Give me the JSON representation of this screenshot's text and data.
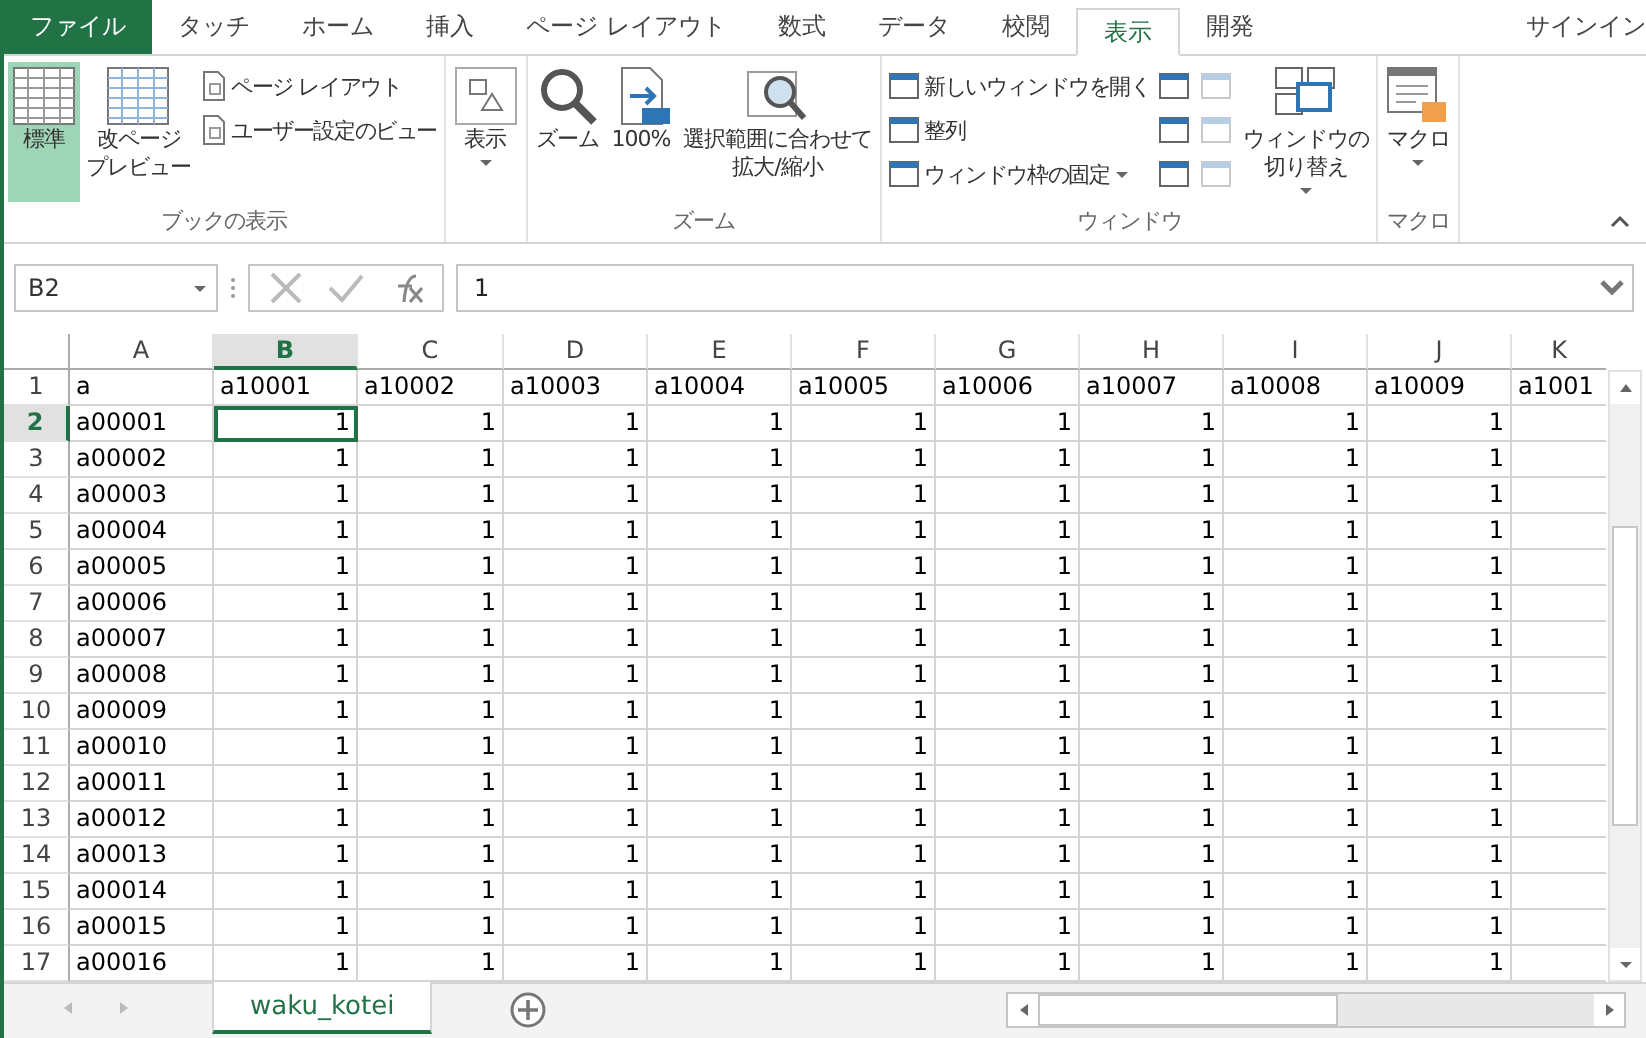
{
  "menu_tabs": [
    {
      "label": "ファイル",
      "kind": "file",
      "selected": false
    },
    {
      "label": "タッチ",
      "kind": "tab",
      "selected": false
    },
    {
      "label": "ホーム",
      "kind": "tab",
      "selected": false
    },
    {
      "label": "挿入",
      "kind": "tab",
      "selected": false
    },
    {
      "label": "ページ レイアウト",
      "kind": "tab",
      "selected": false
    },
    {
      "label": "数式",
      "kind": "tab",
      "selected": false
    },
    {
      "label": "データ",
      "kind": "tab",
      "selected": false
    },
    {
      "label": "校閲",
      "kind": "tab",
      "selected": false
    },
    {
      "label": "表示",
      "kind": "tab",
      "selected": true
    },
    {
      "label": "開発",
      "kind": "tab",
      "selected": false
    }
  ],
  "sign_in": "サインイン",
  "ribbon_groups": [
    {
      "label": "ブックの表示",
      "items": [
        {
          "kind": "large",
          "lines": [
            "標準"
          ],
          "selected": true,
          "dropdown": false
        },
        {
          "kind": "large",
          "lines": [
            "改ページ",
            "プレビュー"
          ],
          "selected": false,
          "dropdown": false
        },
        {
          "kind": "small",
          "label": "ページ レイアウト",
          "dropdown": false
        },
        {
          "kind": "small",
          "label": "ユーザー設定のビュー",
          "dropdown": false
        }
      ]
    },
    {
      "items": [
        {
          "kind": "large",
          "lines": [
            "表示"
          ],
          "selected": false,
          "dropdown": true
        }
      ]
    },
    {
      "label": "ズーム",
      "items": [
        {
          "kind": "large",
          "lines": [
            "ズーム"
          ],
          "selected": false,
          "dropdown": false
        },
        {
          "kind": "large",
          "lines": [
            "100%"
          ],
          "selected": false,
          "dropdown": false
        },
        {
          "kind": "large",
          "lines": [
            "選択範囲に合わせて",
            "拡大/縮小"
          ],
          "selected": false,
          "dropdown": false
        }
      ]
    },
    {
      "label": "ウィンドウ",
      "items": [
        {
          "kind": "small",
          "label": "新しいウィンドウを開く",
          "dropdown": false
        },
        {
          "kind": "small",
          "label": "整列",
          "dropdown": false
        },
        {
          "kind": "small",
          "label": "ウィンドウ枠の固定",
          "dropdown": true
        },
        {
          "kind": "icon",
          "disabled": false
        },
        {
          "kind": "icon",
          "disabled": false
        },
        {
          "kind": "icon",
          "disabled": false
        },
        {
          "kind": "icon",
          "disabled": true
        },
        {
          "kind": "icon",
          "disabled": true
        },
        {
          "kind": "icon",
          "disabled": true
        },
        {
          "kind": "large",
          "lines": [
            "ウィンドウの",
            "切り替え"
          ],
          "selected": false,
          "dropdown": true
        }
      ]
    },
    {
      "label": "マクロ",
      "items": [
        {
          "kind": "large",
          "lines": [
            "マクロ"
          ],
          "selected": false,
          "dropdown": true
        }
      ]
    }
  ],
  "name_box": "B2",
  "formula": "1",
  "columns": [
    {
      "label": "A",
      "selected": false
    },
    {
      "label": "B",
      "selected": true
    },
    {
      "label": "C",
      "selected": false
    },
    {
      "label": "D",
      "selected": false
    },
    {
      "label": "E",
      "selected": false
    },
    {
      "label": "F",
      "selected": false
    },
    {
      "label": "G",
      "selected": false
    },
    {
      "label": "H",
      "selected": false
    },
    {
      "label": "I",
      "selected": false
    },
    {
      "label": "J",
      "selected": false
    },
    {
      "label": "K",
      "selected": false
    }
  ],
  "rows": [
    {
      "number": "1",
      "selected": false,
      "cells": [
        "a",
        "a10001",
        "a10002",
        "a10003",
        "a10004",
        "a10005",
        "a10006",
        "a10007",
        "a10008",
        "a10009",
        "a1001"
      ]
    },
    {
      "number": "2",
      "selected": true,
      "cells": [
        "a00001",
        "1",
        "1",
        "1",
        "1",
        "1",
        "1",
        "1",
        "1",
        "1",
        ""
      ]
    },
    {
      "number": "3",
      "selected": false,
      "cells": [
        "a00002",
        "1",
        "1",
        "1",
        "1",
        "1",
        "1",
        "1",
        "1",
        "1",
        ""
      ]
    },
    {
      "number": "4",
      "selected": false,
      "cells": [
        "a00003",
        "1",
        "1",
        "1",
        "1",
        "1",
        "1",
        "1",
        "1",
        "1",
        ""
      ]
    },
    {
      "number": "5",
      "selected": false,
      "cells": [
        "a00004",
        "1",
        "1",
        "1",
        "1",
        "1",
        "1",
        "1",
        "1",
        "1",
        ""
      ]
    },
    {
      "number": "6",
      "selected": false,
      "cells": [
        "a00005",
        "1",
        "1",
        "1",
        "1",
        "1",
        "1",
        "1",
        "1",
        "1",
        ""
      ]
    },
    {
      "number": "7",
      "selected": false,
      "cells": [
        "a00006",
        "1",
        "1",
        "1",
        "1",
        "1",
        "1",
        "1",
        "1",
        "1",
        ""
      ]
    },
    {
      "number": "8",
      "selected": false,
      "cells": [
        "a00007",
        "1",
        "1",
        "1",
        "1",
        "1",
        "1",
        "1",
        "1",
        "1",
        ""
      ]
    },
    {
      "number": "9",
      "selected": false,
      "cells": [
        "a00008",
        "1",
        "1",
        "1",
        "1",
        "1",
        "1",
        "1",
        "1",
        "1",
        ""
      ]
    },
    {
      "number": "10",
      "selected": false,
      "cells": [
        "a00009",
        "1",
        "1",
        "1",
        "1",
        "1",
        "1",
        "1",
        "1",
        "1",
        ""
      ]
    },
    {
      "number": "11",
      "selected": false,
      "cells": [
        "a00010",
        "1",
        "1",
        "1",
        "1",
        "1",
        "1",
        "1",
        "1",
        "1",
        ""
      ]
    },
    {
      "number": "12",
      "selected": false,
      "cells": [
        "a00011",
        "1",
        "1",
        "1",
        "1",
        "1",
        "1",
        "1",
        "1",
        "1",
        ""
      ]
    },
    {
      "number": "13",
      "selected": false,
      "cells": [
        "a00012",
        "1",
        "1",
        "1",
        "1",
        "1",
        "1",
        "1",
        "1",
        "1",
        ""
      ]
    },
    {
      "number": "14",
      "selected": false,
      "cells": [
        "a00013",
        "1",
        "1",
        "1",
        "1",
        "1",
        "1",
        "1",
        "1",
        "1",
        ""
      ]
    },
    {
      "number": "15",
      "selected": false,
      "cells": [
        "a00014",
        "1",
        "1",
        "1",
        "1",
        "1",
        "1",
        "1",
        "1",
        "1",
        ""
      ]
    },
    {
      "number": "16",
      "selected": false,
      "cells": [
        "a00015",
        "1",
        "1",
        "1",
        "1",
        "1",
        "1",
        "1",
        "1",
        "1",
        ""
      ]
    },
    {
      "number": "17",
      "selected": false,
      "cells": [
        "a00016",
        "1",
        "1",
        "1",
        "1",
        "1",
        "1",
        "1",
        "1",
        "1",
        ""
      ]
    }
  ],
  "sheet_tabs": [
    {
      "label": "waku_kotei",
      "selected": true
    }
  ]
}
